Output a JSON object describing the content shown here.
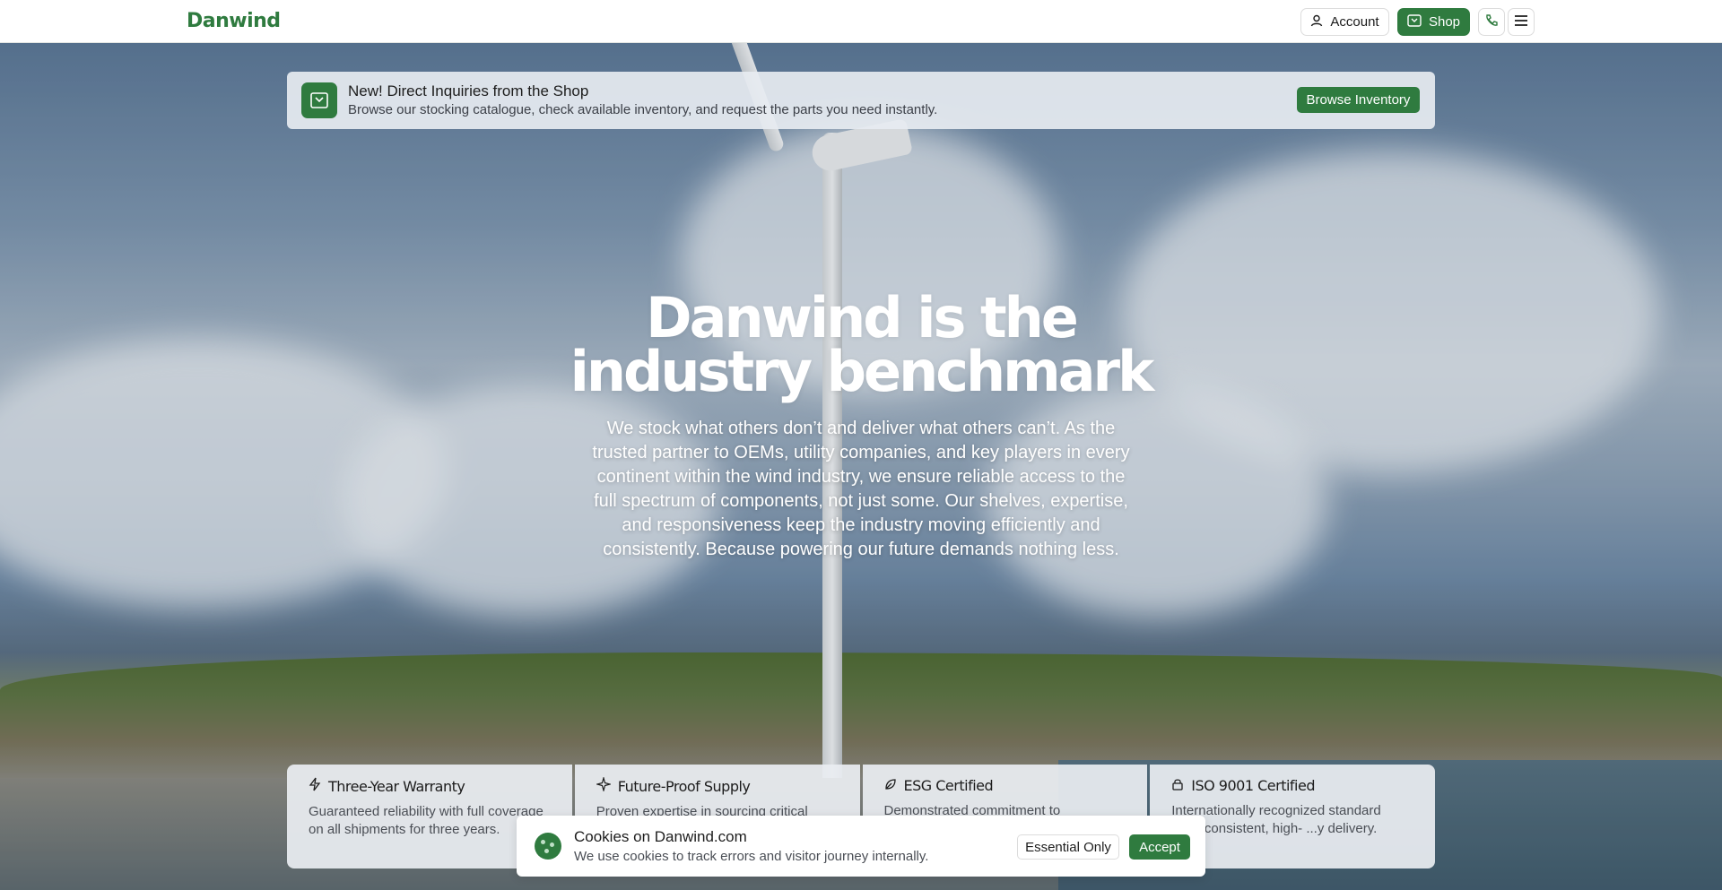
{
  "header": {
    "logo": "Danwind",
    "account_label": "Account",
    "shop_label": "Shop",
    "icons": [
      "user-icon",
      "cart-icon",
      "phone-icon",
      "menu-icon"
    ]
  },
  "banner": {
    "title": "New! Direct Inquiries from the Shop",
    "subtitle": "Browse our stocking catalogue, check available inventory, and request the parts you need instantly.",
    "button_label": "Browse Inventory"
  },
  "hero": {
    "title_line1": "Danwind is the",
    "title_line2": "industry benchmark",
    "body": "We stock what others don’t and deliver what others can’t. As the trusted partner to OEMs, utility companies, and key players in every continent within the wind industry, we ensure reliable access to the full spectrum of components, not just some. Our shelves, expertise, and responsiveness keep the industry moving efficiently and consistently. Because powering our future demands nothing less."
  },
  "features": [
    {
      "icon": "bolt-icon",
      "title": "Three-Year Warranty",
      "text": "Guaranteed reliability with full coverage on all shipments for three years."
    },
    {
      "icon": "sparkle-icon",
      "title": "Future-Proof Supply",
      "text": "Proven expertise in sourcing critical"
    },
    {
      "icon": "leaf-icon",
      "title": "ESG Certified",
      "text": "Demonstrated commitment to"
    },
    {
      "icon": "lock-icon",
      "title": "ISO 9001 Certified",
      "text": "Internationally recognized standard ...ing consistent, high- ...y delivery."
    }
  ],
  "cookie": {
    "title": "Cookies on Danwind.com",
    "subtitle": "We use cookies to track errors and visitor journey internally.",
    "essential_label": "Essential Only",
    "accept_label": "Accept"
  },
  "colors": {
    "brand_green": "#2f7b3f",
    "banner_bg": "#e7ebf1",
    "white": "#ffffff"
  }
}
